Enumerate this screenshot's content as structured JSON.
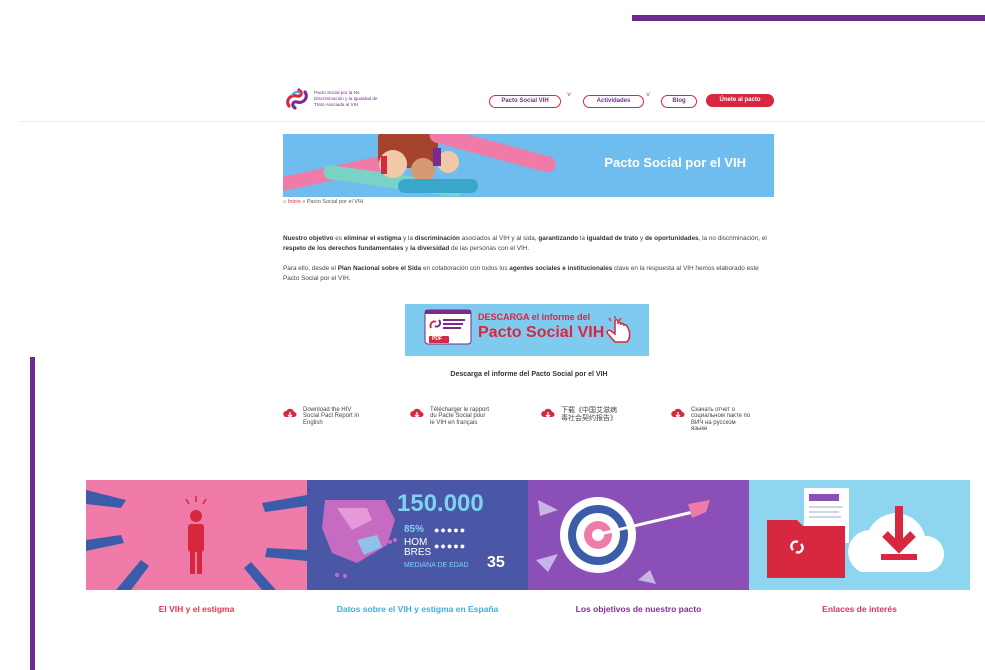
{
  "header": {
    "logo_text": "Pacto Social por la No Discriminación y la Igualdad de Trato Asociada al VIH",
    "nav": [
      {
        "label": "Pacto Social VIH",
        "has_caret": true
      },
      {
        "label": "Actividades",
        "has_caret": true
      },
      {
        "label": "Blog",
        "has_caret": false
      }
    ],
    "cta_label": "Únete al pacto"
  },
  "banner": {
    "title": "Pacto Social por el VIH"
  },
  "breadcrumb": {
    "home": "Inicio",
    "sep": "»",
    "current": "Pacto Social por el VIH"
  },
  "intro": {
    "p1": [
      {
        "t": "Nuestro objetivo",
        "b": true
      },
      {
        "t": " es ",
        "b": false
      },
      {
        "t": "eliminar el estigma",
        "b": true
      },
      {
        "t": " y la ",
        "b": false
      },
      {
        "t": "discriminación",
        "b": true
      },
      {
        "t": "  asociados al VIH y al sida, ",
        "b": false
      },
      {
        "t": "garantizando",
        "b": true
      },
      {
        "t": " la ",
        "b": false
      },
      {
        "t": "igualdad de trato",
        "b": true
      },
      {
        "t": " y ",
        "b": false
      },
      {
        "t": "de oportunidades",
        "b": true
      },
      {
        "t": ", la no discriminación, el ",
        "b": false
      },
      {
        "t": "respeto de los derechos fundamentales",
        "b": true
      },
      {
        "t": " y ",
        "b": false
      },
      {
        "t": "la diversidad",
        "b": true
      },
      {
        "t": " de las personas con el VIH.",
        "b": false
      }
    ],
    "p2": [
      {
        "t": " Para ello, desde el ",
        "b": false
      },
      {
        "t": "Plan Nacional sobre el Sida",
        "b": true
      },
      {
        "t": " en colaboración con todos los ",
        "b": false
      },
      {
        "t": "agentes sociales e institucionales",
        "b": true
      },
      {
        "t": " clave en la respuesta al VIH hemos elaborado este Pacto Social por el VIH.",
        "b": false
      }
    ]
  },
  "download": {
    "banner_line1": "DESCARGA el informe del",
    "banner_line2": "Pacto Social VIH",
    "pdf_label": "PDF",
    "caption": "Descarga el informe del Pacto Social por el VIH",
    "languages": [
      "Download the HIV Social Pact Report in English",
      "Télécharger le rapport du Pacte Social pour le VIH en français",
      "下载《中国艾滋病毒社会契约报告》",
      "Скачать отчет о социальном пакте по ВИЧ на русском языке"
    ]
  },
  "cards": [
    {
      "caption": "El VIH y el estigma",
      "color": "#e8354e"
    },
    {
      "caption": "Datos sobre el VIH y estigma en España",
      "color": "#3bb0dc"
    },
    {
      "caption": "Los objetivos de nuestro pacto",
      "color": "#8b2b9e"
    },
    {
      "caption": "Enlaces de interés",
      "color": "#d9326b"
    }
  ],
  "stats": {
    "big": "150.000",
    "pct": "85%",
    "hom": "HOM",
    "bres": "BRES",
    "median_label": "MEDIANA DE EDAD",
    "median": "35"
  },
  "colors": {
    "accent_red": "#d7283f",
    "purple": "#6a2c8f",
    "banner_blue": "#6fbcee"
  }
}
